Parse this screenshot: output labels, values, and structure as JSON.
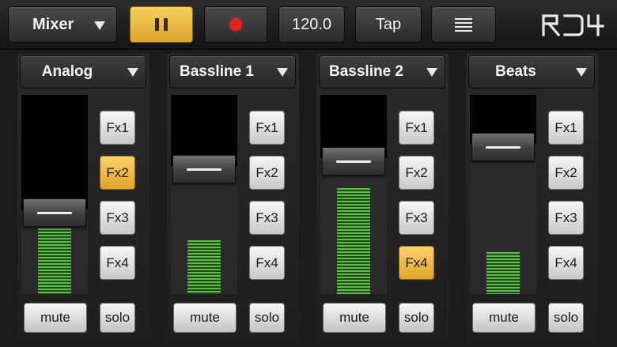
{
  "toolbar": {
    "mode_label": "Mixer",
    "tempo_value": "120.0",
    "tap_label": "Tap",
    "logo_text": "RD4",
    "pause_active": true
  },
  "colors": {
    "active": "#eab842",
    "record": "#e3201b",
    "meter_green": "#5fbd4a"
  },
  "icons": {
    "pause": "pause-icon",
    "record": "record-dot-icon",
    "menu": "menu-lines-icon",
    "dropdown": "triangle-down-icon"
  },
  "channels": [
    {
      "name": "Analog",
      "fader_level": 0.48,
      "meter_level": 0.33,
      "fx_labels": [
        "Fx1",
        "Fx2",
        "Fx3",
        "Fx4"
      ],
      "fx_active": [
        false,
        true,
        false,
        false
      ],
      "mute_label": "mute",
      "solo_label": "solo"
    },
    {
      "name": "Bassline 1",
      "fader_level": 0.7,
      "meter_level": 0.27,
      "fx_labels": [
        "Fx1",
        "Fx2",
        "Fx3",
        "Fx4"
      ],
      "fx_active": [
        false,
        false,
        false,
        false
      ],
      "mute_label": "mute",
      "solo_label": "solo"
    },
    {
      "name": "Bassline 2",
      "fader_level": 0.74,
      "meter_level": 0.53,
      "fx_labels": [
        "Fx1",
        "Fx2",
        "Fx3",
        "Fx4"
      ],
      "fx_active": [
        false,
        false,
        false,
        true
      ],
      "mute_label": "mute",
      "solo_label": "solo"
    },
    {
      "name": "Beats",
      "fader_level": 0.81,
      "meter_level": 0.21,
      "fx_labels": [
        "Fx1",
        "Fx2",
        "Fx3",
        "Fx4"
      ],
      "fx_active": [
        false,
        false,
        false,
        false
      ],
      "mute_label": "mute",
      "solo_label": "solo"
    }
  ]
}
